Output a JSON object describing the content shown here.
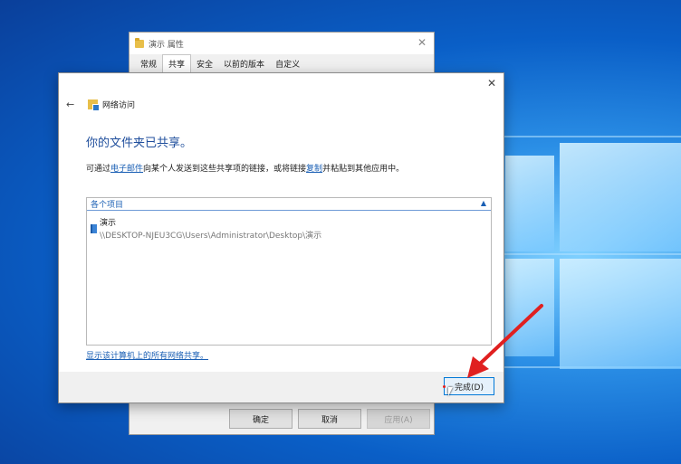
{
  "properties_dialog": {
    "title": "演示 属性",
    "tabs": [
      "常规",
      "共享",
      "安全",
      "以前的版本",
      "自定义"
    ],
    "active_tab": "共享",
    "buttons": {
      "ok": "确定",
      "cancel": "取消",
      "apply": "应用(A)"
    }
  },
  "wizard": {
    "nav_title": "网络访问",
    "heading": "你的文件夹已共享。",
    "description": {
      "part1": "可通过",
      "email_link": "电子邮件",
      "part2": "向某个人发送到这些共享项的链接，或将链接",
      "copy_link": "复制",
      "part3": "并粘贴到其他应用中。"
    },
    "items_header": "各个项目",
    "items": [
      {
        "name": "演示",
        "path": "\\\\DESKTOP-NJEU3CG\\Users\\Administrator\\Desktop\\演示"
      }
    ],
    "show_all_link": "显示该计算机上的所有网络共享。",
    "finish_button": "完成(D)"
  },
  "colors": {
    "heading": "#1f4e9c",
    "link": "#1a5fb4",
    "annotation_arrow": "#e02020"
  },
  "icons": [
    "folder-icon",
    "close-icon",
    "back-arrow-icon",
    "network-access-icon",
    "collapse-chevron-icon",
    "shared-folder-icon",
    "mouse-cursor-icon",
    "annotation-arrow"
  ]
}
